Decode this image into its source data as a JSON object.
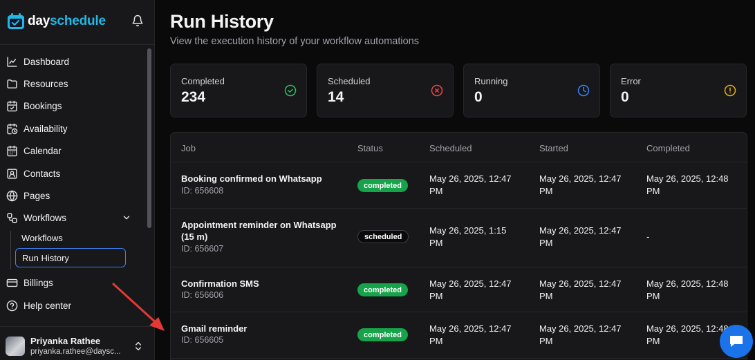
{
  "brand": {
    "day": "day",
    "schedule": "schedule"
  },
  "nav": {
    "items": [
      {
        "label": "Dashboard",
        "icon": "chart-line-icon"
      },
      {
        "label": "Resources",
        "icon": "folder-icon"
      },
      {
        "label": "Bookings",
        "icon": "calendar-check-icon"
      },
      {
        "label": "Availability",
        "icon": "calendar-clock-icon"
      },
      {
        "label": "Calendar",
        "icon": "calendar-icon"
      },
      {
        "label": "Contacts",
        "icon": "contact-card-icon"
      },
      {
        "label": "Pages",
        "icon": "globe-icon"
      },
      {
        "label": "Workflows",
        "icon": "workflow-icon"
      }
    ],
    "workflow_sub": [
      "Workflows",
      "Run History"
    ],
    "bottom": [
      {
        "label": "Billings",
        "icon": "credit-card-icon"
      },
      {
        "label": "Help center",
        "icon": "help-circle-icon"
      }
    ]
  },
  "user": {
    "name": "Priyanka Rathee",
    "email": "priyanka.rathee@daysc..."
  },
  "page": {
    "title": "Run History",
    "subtitle": "View the execution history of your workflow automations"
  },
  "stats": [
    {
      "label": "Completed",
      "value": "234",
      "icon": "check-circle-icon",
      "color": "#22c55e"
    },
    {
      "label": "Scheduled",
      "value": "14",
      "icon": "x-circle-icon",
      "color": "#ef4444"
    },
    {
      "label": "Running",
      "value": "0",
      "icon": "clock-icon",
      "color": "#3b82f6"
    },
    {
      "label": "Error",
      "value": "0",
      "icon": "alert-circle-icon",
      "color": "#eab308"
    }
  ],
  "table": {
    "headers": [
      "Job",
      "Status",
      "Scheduled",
      "Started",
      "Completed"
    ],
    "rows": [
      {
        "job": "Booking confirmed on Whatsapp",
        "id": "ID: 656608",
        "status": "completed",
        "scheduled": [
          "May 26, 2025, 12:47",
          "PM"
        ],
        "started": [
          "May 26, 2025, 12:47",
          "PM"
        ],
        "completed": [
          "May 26, 2025, 12:48",
          "PM"
        ]
      },
      {
        "job": "Appointment reminder on Whatsapp (15 m)",
        "id": "ID: 656607",
        "status": "scheduled",
        "scheduled": [
          "May 26, 2025, 1:15",
          "PM"
        ],
        "started": [
          "May 26, 2025, 12:47",
          "PM"
        ],
        "completed": [
          "-",
          ""
        ]
      },
      {
        "job": "Confirmation SMS",
        "id": "ID: 656606",
        "status": "completed",
        "scheduled": [
          "May 26, 2025, 12:47",
          "PM"
        ],
        "started": [
          "May 26, 2025, 12:47",
          "PM"
        ],
        "completed": [
          "May 26, 2025, 12:48",
          "PM"
        ]
      },
      {
        "job": "Gmail reminder",
        "id": "ID: 656605",
        "status": "completed",
        "scheduled": [
          "May 26, 2025, 12:47",
          "PM"
        ],
        "started": [
          "May 26, 2025, 12:47",
          "PM"
        ],
        "completed": [
          "May 26, 2025, 12:48",
          "PM"
        ]
      }
    ]
  },
  "colors": {
    "accent": "#3b82f6",
    "brand_cyan": "#22b8e6",
    "success": "#16a34a",
    "annotation_arrow": "#e53935",
    "chat": "#1a73e8"
  }
}
